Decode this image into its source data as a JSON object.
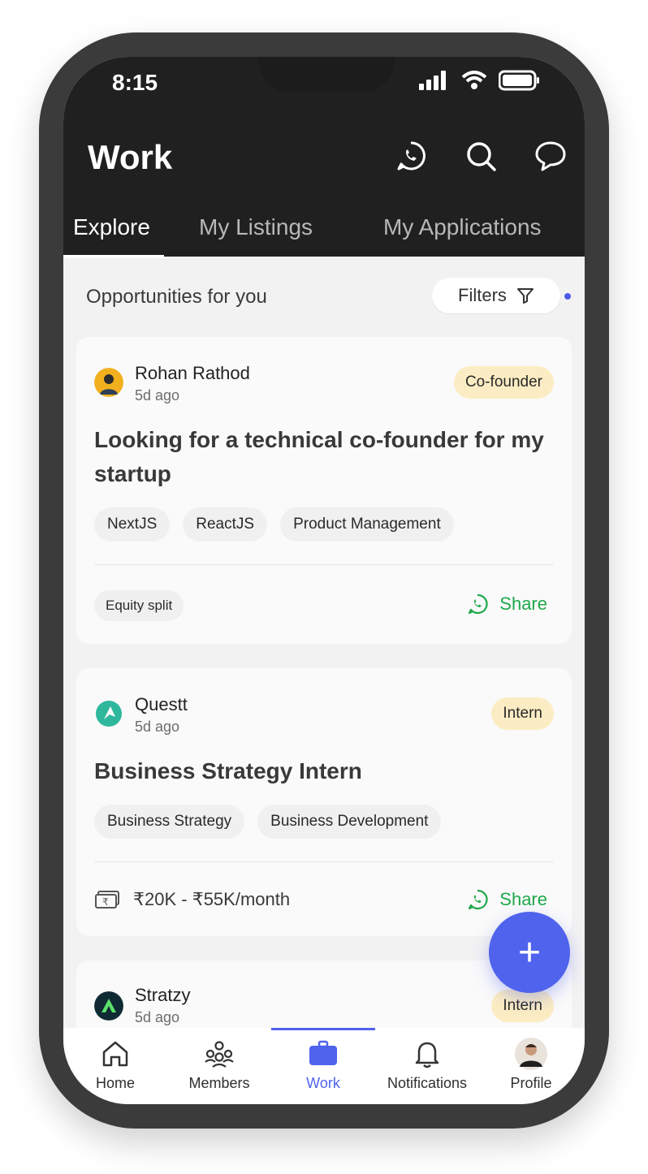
{
  "status_bar": {
    "time": "8:15"
  },
  "header": {
    "title": "Work"
  },
  "tabs": [
    {
      "label": "Explore",
      "active": true
    },
    {
      "label": "My Listings",
      "active": false
    },
    {
      "label": "My Applications",
      "active": false
    }
  ],
  "feed": {
    "section_title": "Opportunities for you",
    "filters_label": "Filters"
  },
  "cards": [
    {
      "author": "Rohan Rathod",
      "posted": "5d ago",
      "badge": "Co-founder",
      "title": "Looking for a technical co-founder for my startup",
      "skills": [
        "NextJS",
        "ReactJS",
        "Product Management"
      ],
      "footer_chip": "Equity split",
      "share_label": "Share"
    },
    {
      "author": "Questt",
      "posted": "5d ago",
      "badge": "Intern",
      "title": "Business Strategy Intern",
      "skills": [
        "Business Strategy",
        "Business Development"
      ],
      "salary": "₹20K - ₹55K/month",
      "share_label": "Share"
    },
    {
      "author": "Stratzy",
      "posted": "5d ago",
      "badge": "Intern"
    }
  ],
  "fab": {
    "label": "+"
  },
  "bottom_nav": [
    {
      "label": "Home",
      "icon": "home-icon",
      "active": false
    },
    {
      "label": "Members",
      "icon": "members-icon",
      "active": false
    },
    {
      "label": "Work",
      "icon": "briefcase-icon",
      "active": true
    },
    {
      "label": "Notifications",
      "icon": "bell-icon",
      "active": false
    },
    {
      "label": "Profile",
      "icon": "profile-avatar",
      "active": false
    }
  ],
  "colors": {
    "accent": "#4f63ec",
    "header_bg": "#202020",
    "badge_bg": "#fbecc3",
    "share": "#20a84a"
  }
}
